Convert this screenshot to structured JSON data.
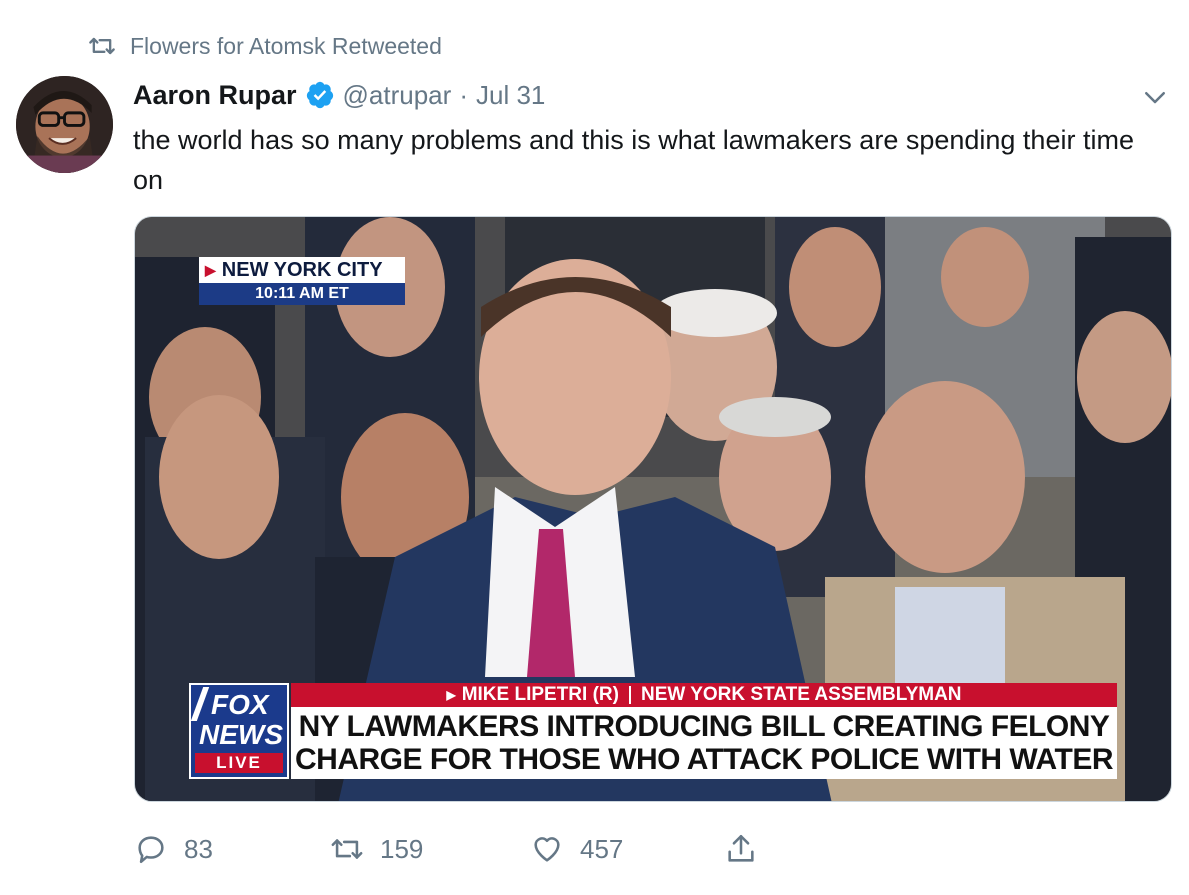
{
  "social_context": {
    "text": "Flowers for Atomsk Retweeted",
    "icon": "retweet-icon"
  },
  "author": {
    "name": "Aaron Rupar",
    "verified": true,
    "handle": "@atrupar",
    "separator": "·",
    "date": "Jul 31"
  },
  "tweet": {
    "text": "the world has so many problems and this is what lawmakers are spending their time on"
  },
  "media": {
    "location": {
      "city": "NEW YORK CITY",
      "time": "10:11 AM ET"
    },
    "network": {
      "line1": "FOX",
      "line2": "NEWS",
      "live": "LIVE"
    },
    "chyron": {
      "speaker": "MIKE LIPETRI (R)",
      "title": "NEW YORK STATE ASSEMBLYMAN",
      "headline_line1": "NY LAWMAKERS INTRODUCING BILL CREATING FELONY",
      "headline_line2": "CHARGE FOR THOSE WHO ATTACK POLICE WITH WATER"
    }
  },
  "actions": {
    "replies": "83",
    "retweets": "159",
    "likes": "457"
  },
  "colors": {
    "verified": "#1da1f2",
    "muted": "#657786",
    "fox_red": "#c8102e",
    "fox_blue": "#1b3a8c"
  }
}
